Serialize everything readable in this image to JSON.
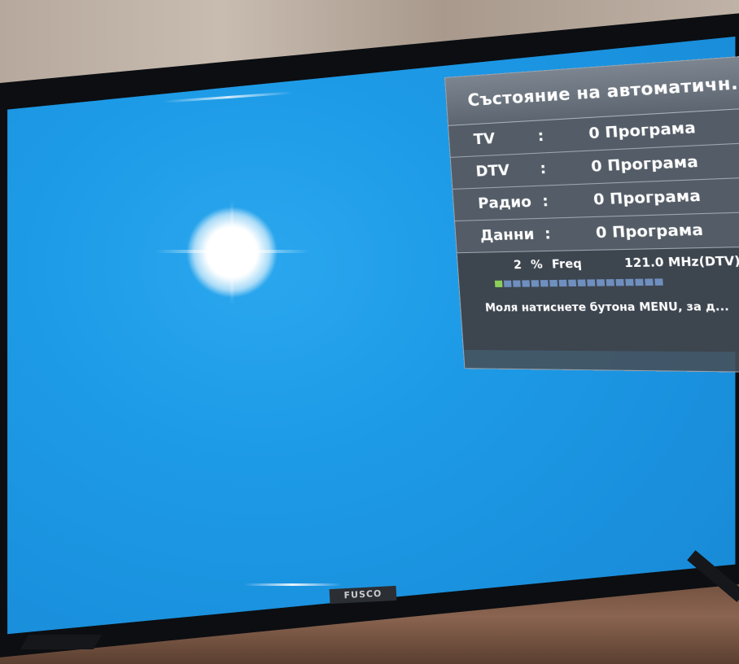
{
  "osd": {
    "title": "Състояние на автоматичн...",
    "rows": [
      {
        "label": "TV",
        "colon": ":",
        "value": "0 Програма"
      },
      {
        "label": "DTV",
        "colon": ":",
        "value": "0 Програма"
      },
      {
        "label": "Радио",
        "colon": ":",
        "value": "0 Програма"
      },
      {
        "label": "Данни",
        "colon": ":",
        "value": "0 Програма"
      }
    ],
    "scan": {
      "percent": "2",
      "percent_sign": "%",
      "freq_label": "Freq",
      "freq_value": "121.0 MHz(DTV)",
      "progress_fraction": 0.02,
      "segments_total": 18,
      "segments_filled": 1
    },
    "hint": "Моля натиснете бутона MENU, за д..."
  },
  "tv": {
    "brand": "FUSCO"
  },
  "colors": {
    "screen": "#1d9ae6",
    "osd_panel": "#46505a",
    "progress_on": "#8ccf5a",
    "progress_off": "#6f8fbf"
  }
}
